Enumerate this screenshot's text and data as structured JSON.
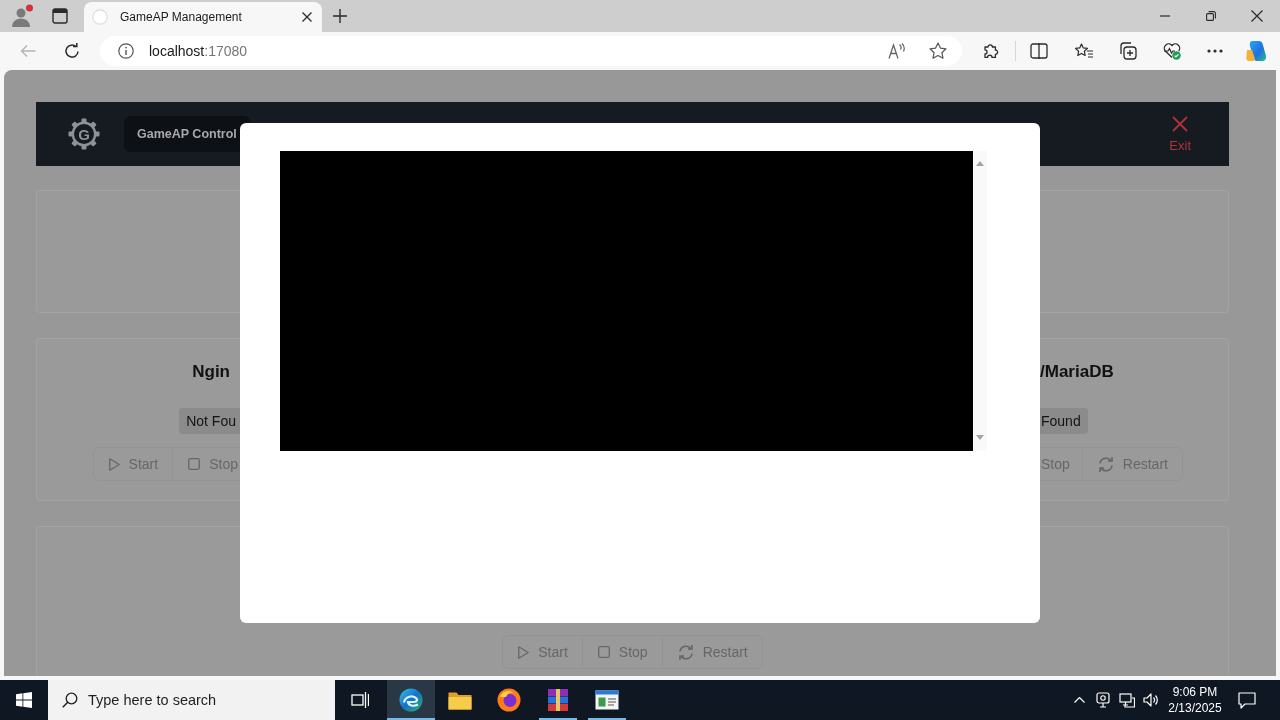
{
  "browser": {
    "tabs": [
      {
        "title": "GameAP Management",
        "selected": true
      }
    ],
    "back": {
      "disabled": true
    },
    "address": {
      "host": "localhost",
      "port": ":17080"
    }
  },
  "app": {
    "logo_letter": "G",
    "brand": "GameAP Control",
    "exit": "Exit"
  },
  "services": [
    {
      "name": "Ngin",
      "status": "Not Fou",
      "buttons": [
        {
          "kind": "start",
          "label": "Start",
          "icon": true
        },
        {
          "kind": "stop",
          "label": "Stop",
          "icon": true
        }
      ]
    },
    {
      "name": "/MariaDB",
      "status": "Found",
      "buttons": [
        {
          "kind": "stop",
          "label": "Stop",
          "icon": false
        },
        {
          "kind": "restart",
          "label": "Restart",
          "icon": true
        }
      ]
    },
    {
      "buttons": [
        {
          "kind": "start",
          "label": "Start",
          "icon": true
        },
        {
          "kind": "stop",
          "label": "Stop",
          "icon": true
        },
        {
          "kind": "restart",
          "label": "Restart",
          "icon": true
        }
      ]
    }
  ],
  "taskbar": {
    "search": {
      "placeholder": "Type here to search"
    },
    "apps": [
      {
        "kind": "edge",
        "selected": true,
        "running": true
      },
      {
        "kind": "explorer",
        "selected": false,
        "running": false
      },
      {
        "kind": "firefox",
        "selected": false,
        "running": false
      },
      {
        "kind": "winrar",
        "selected": false,
        "running": true
      },
      {
        "kind": "window",
        "selected": false,
        "running": true
      }
    ],
    "time": "9:06 PM",
    "date": "2/13/2025"
  }
}
